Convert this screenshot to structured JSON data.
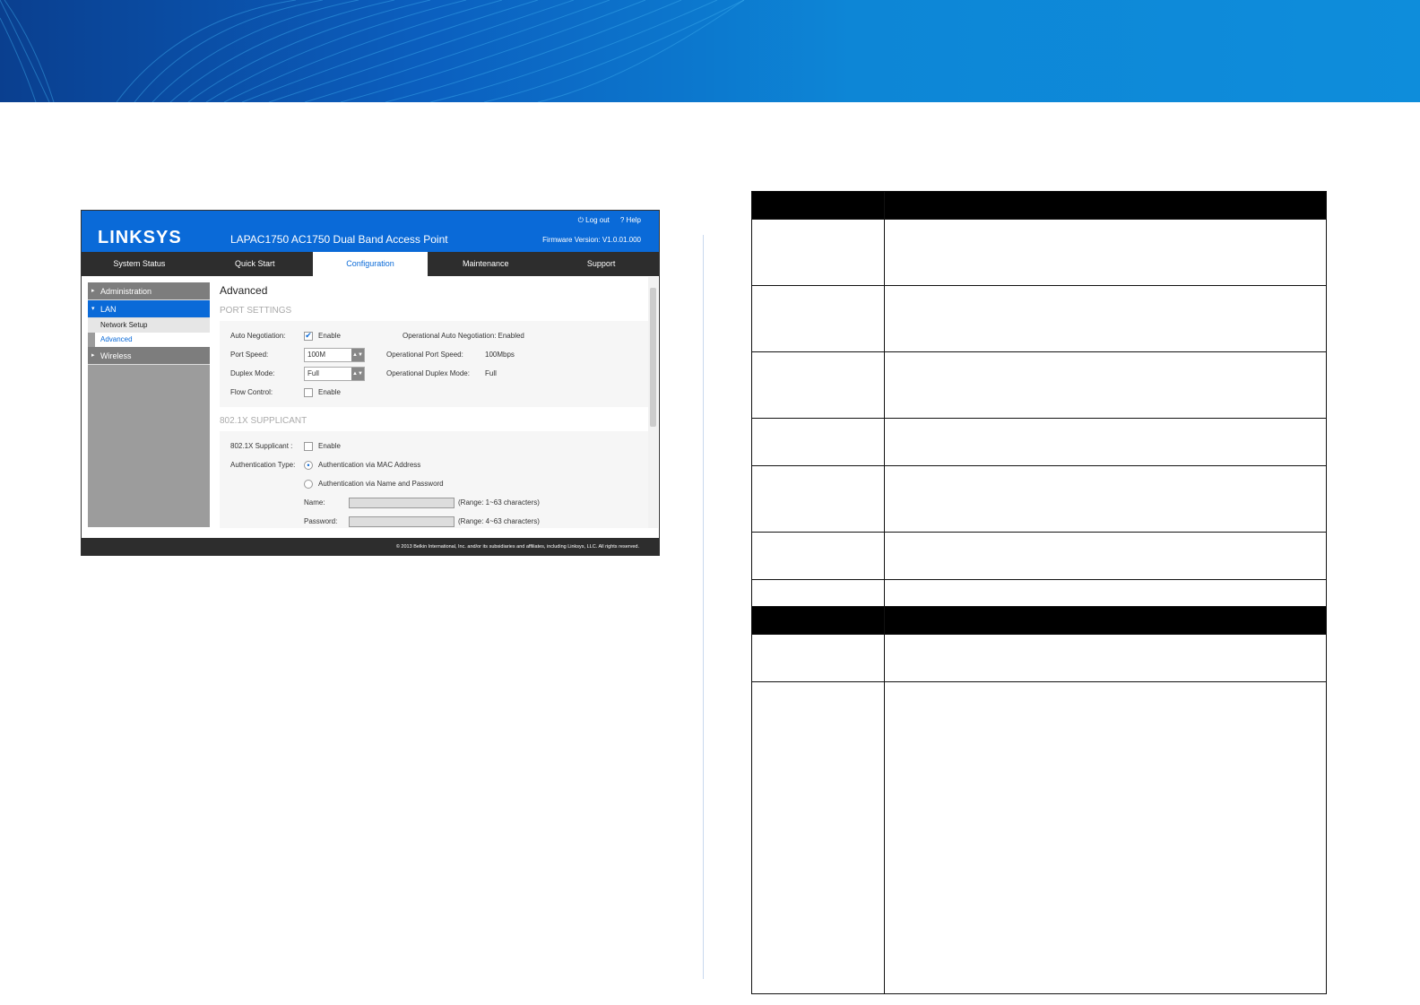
{
  "screenshot": {
    "logo": "LINKSYS",
    "title": "LAPAC1750 AC1750 Dual Band Access Point",
    "logout": "Log out",
    "help": "Help",
    "firmware": "Firmware Version: V1.0.01.000",
    "nav": [
      "System Status",
      "Quick Start",
      "Configuration",
      "Maintenance",
      "Support"
    ],
    "sidebar": {
      "administration": "Administration",
      "lan": "LAN",
      "network_setup": "Network Setup",
      "advanced": "Advanced",
      "wireless": "Wireless"
    },
    "page_title": "Advanced",
    "port_settings": {
      "heading": "PORT SETTINGS",
      "auto_neg": "Auto Negotiation:",
      "enable": "Enable",
      "op_auto_neg": "Operational Auto Negotiation:",
      "op_auto_neg_val": "Enabled",
      "port_speed": "Port Speed:",
      "port_speed_val": "100M",
      "op_port_speed": "Operational Port Speed:",
      "op_port_speed_val": "100Mbps",
      "duplex": "Duplex Mode:",
      "duplex_val": "Full",
      "op_duplex": "Operational Duplex Mode:",
      "op_duplex_val": "Full",
      "flow": "Flow Control:"
    },
    "supplicant": {
      "heading": "802.1X SUPPLICANT",
      "label": "802.1X Supplicant :",
      "enable": "Enable",
      "auth_type": "Authentication Type:",
      "via_mac": "Authentication via MAC Address",
      "via_name": "Authentication via Name and Password",
      "name": "Name:",
      "name_range": "(Range: 1~63 characters)",
      "password": "Password:",
      "password_range": "(Range: 4~63 characters)"
    },
    "footer": "© 2013 Belkin International, Inc. and/or its subsidiaries and affiliates, including Linksys, LLC. All rights reserved."
  }
}
